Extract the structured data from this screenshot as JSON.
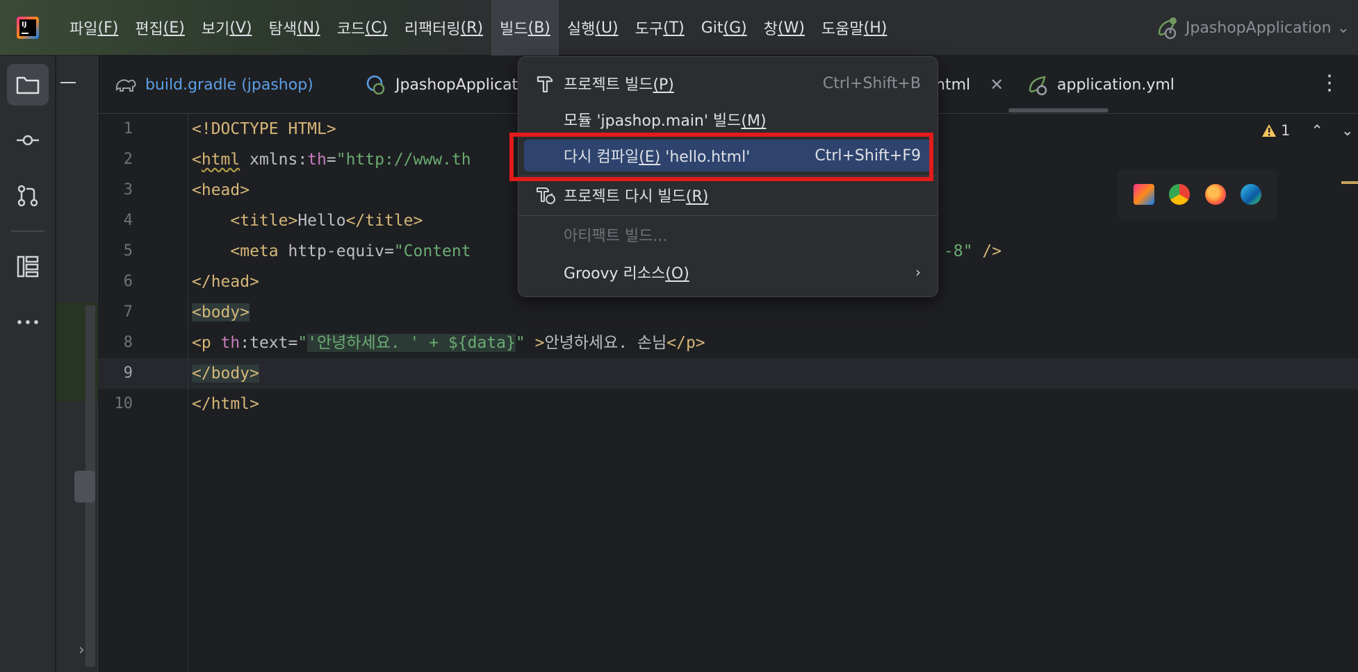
{
  "menubar": {
    "items": [
      {
        "label": "파일",
        "mnemonic": "(F)"
      },
      {
        "label": "편집",
        "mnemonic": "(E)"
      },
      {
        "label": "보기",
        "mnemonic": "(V)"
      },
      {
        "label": "탐색",
        "mnemonic": "(N)"
      },
      {
        "label": "코드",
        "mnemonic": "(C)"
      },
      {
        "label": "리팩터링",
        "mnemonic": "(R)"
      },
      {
        "label": "빌드",
        "mnemonic": "(B)"
      },
      {
        "label": "실행",
        "mnemonic": "(U)"
      },
      {
        "label": "도구",
        "mnemonic": "(T)"
      },
      {
        "label": "Git",
        "mnemonic": "(G)"
      },
      {
        "label": "창",
        "mnemonic": "(W)"
      },
      {
        "label": "도움말",
        "mnemonic": "(H)"
      }
    ],
    "active_index": 6
  },
  "run_config": {
    "label": "JpashopApplication",
    "chevron": "⌄"
  },
  "app_logo_text": "IJ",
  "tabs": [
    {
      "label": "build.gradle (jpashop)",
      "icon": "elephant-icon"
    },
    {
      "label": "JpashopApplicati",
      "icon": "spring-run-icon"
    },
    {
      "label": "html",
      "icon": "html-file-icon"
    },
    {
      "label": "application.yml",
      "icon": "spring-config-icon"
    }
  ],
  "tab_close_glyph": "✕",
  "kebab_glyph": "⋮",
  "editor": {
    "line_numbers": [
      "1",
      "2",
      "3",
      "4",
      "5",
      "6",
      "7",
      "8",
      "9",
      "10"
    ],
    "current_line": 9,
    "lines": {
      "l1": "<!DOCTYPE HTML>",
      "l2_a": "<",
      "l2_tag": "html",
      "l2_b": " xmlns:",
      "l2_ns": "th",
      "l2_c": "=",
      "l2_str": "\"http://www.th",
      "l3": "<head>",
      "l4_indent": "    ",
      "l4_open": "<title>",
      "l4_text": "Hello",
      "l4_close": "</title>",
      "l5_indent": "    ",
      "l5_open": "<meta",
      "l5_attr": " http-equiv=",
      "l5_str": "\"Content",
      "l5_tail_str": "-8\"",
      "l5_tail": " />",
      "l6": "</head>",
      "l7": "<body>",
      "l8_open": "<p",
      "l8_ns": " th",
      "l8_attr": ":text=",
      "l8_q1": "\"",
      "l8_expr": "'안녕하세요. ' + ${data}",
      "l8_q2": "\"",
      "l8_gt": " >",
      "l8_text": "안녕하세요. 손님",
      "l8_close": "</p>",
      "l9": "</body>",
      "l10": "</html>"
    },
    "inspection": {
      "count": "1",
      "up": "⌃",
      "down": "⌄"
    }
  },
  "build_menu": {
    "items": [
      {
        "label": "프로젝트 빌드",
        "mnemonic": "(P)",
        "shortcut": "Ctrl+Shift+B",
        "icon": "hammer-icon"
      },
      {
        "label": "모듈 'jpashop.main' 빌드",
        "mnemonic": "(M)",
        "shortcut": ""
      },
      {
        "label_a": "다시 컴파일",
        "mnemonic": "(E)",
        "label_b": " 'hello.html'",
        "shortcut": "Ctrl+Shift+F9"
      },
      {
        "label": "프로젝트 다시 빌드",
        "mnemonic": "(R)",
        "shortcut": "",
        "icon": "rebuild-icon"
      },
      {
        "label": "아티팩트 빌드...",
        "shortcut": ""
      },
      {
        "label": "Groovy 리소스",
        "mnemonic": "(O)",
        "arrow": "›"
      }
    ],
    "selected_index": 2
  },
  "colors": {
    "accent": "#2e436e",
    "highlight_box": "#e21b1b",
    "tag": "#d5b778",
    "string": "#6aab73",
    "namespace": "#c77dbb"
  }
}
